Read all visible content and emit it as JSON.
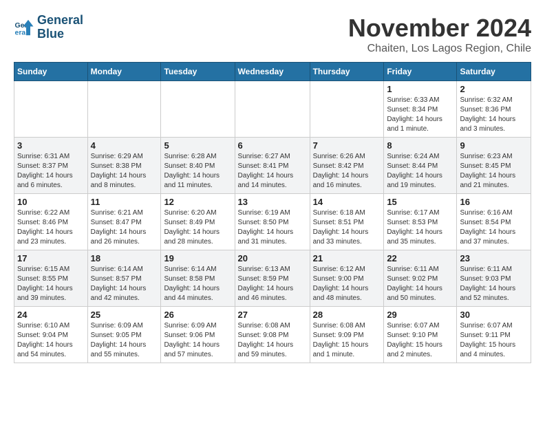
{
  "logo": {
    "line1": "General",
    "line2": "Blue"
  },
  "title": "November 2024",
  "subtitle": "Chaiten, Los Lagos Region, Chile",
  "days_of_week": [
    "Sunday",
    "Monday",
    "Tuesday",
    "Wednesday",
    "Thursday",
    "Friday",
    "Saturday"
  ],
  "weeks": [
    [
      {
        "day": "",
        "info": ""
      },
      {
        "day": "",
        "info": ""
      },
      {
        "day": "",
        "info": ""
      },
      {
        "day": "",
        "info": ""
      },
      {
        "day": "",
        "info": ""
      },
      {
        "day": "1",
        "info": "Sunrise: 6:33 AM\nSunset: 8:34 PM\nDaylight: 14 hours and 1 minute."
      },
      {
        "day": "2",
        "info": "Sunrise: 6:32 AM\nSunset: 8:36 PM\nDaylight: 14 hours and 3 minutes."
      }
    ],
    [
      {
        "day": "3",
        "info": "Sunrise: 6:31 AM\nSunset: 8:37 PM\nDaylight: 14 hours and 6 minutes."
      },
      {
        "day": "4",
        "info": "Sunrise: 6:29 AM\nSunset: 8:38 PM\nDaylight: 14 hours and 8 minutes."
      },
      {
        "day": "5",
        "info": "Sunrise: 6:28 AM\nSunset: 8:40 PM\nDaylight: 14 hours and 11 minutes."
      },
      {
        "day": "6",
        "info": "Sunrise: 6:27 AM\nSunset: 8:41 PM\nDaylight: 14 hours and 14 minutes."
      },
      {
        "day": "7",
        "info": "Sunrise: 6:26 AM\nSunset: 8:42 PM\nDaylight: 14 hours and 16 minutes."
      },
      {
        "day": "8",
        "info": "Sunrise: 6:24 AM\nSunset: 8:44 PM\nDaylight: 14 hours and 19 minutes."
      },
      {
        "day": "9",
        "info": "Sunrise: 6:23 AM\nSunset: 8:45 PM\nDaylight: 14 hours and 21 minutes."
      }
    ],
    [
      {
        "day": "10",
        "info": "Sunrise: 6:22 AM\nSunset: 8:46 PM\nDaylight: 14 hours and 23 minutes."
      },
      {
        "day": "11",
        "info": "Sunrise: 6:21 AM\nSunset: 8:47 PM\nDaylight: 14 hours and 26 minutes."
      },
      {
        "day": "12",
        "info": "Sunrise: 6:20 AM\nSunset: 8:49 PM\nDaylight: 14 hours and 28 minutes."
      },
      {
        "day": "13",
        "info": "Sunrise: 6:19 AM\nSunset: 8:50 PM\nDaylight: 14 hours and 31 minutes."
      },
      {
        "day": "14",
        "info": "Sunrise: 6:18 AM\nSunset: 8:51 PM\nDaylight: 14 hours and 33 minutes."
      },
      {
        "day": "15",
        "info": "Sunrise: 6:17 AM\nSunset: 8:53 PM\nDaylight: 14 hours and 35 minutes."
      },
      {
        "day": "16",
        "info": "Sunrise: 6:16 AM\nSunset: 8:54 PM\nDaylight: 14 hours and 37 minutes."
      }
    ],
    [
      {
        "day": "17",
        "info": "Sunrise: 6:15 AM\nSunset: 8:55 PM\nDaylight: 14 hours and 39 minutes."
      },
      {
        "day": "18",
        "info": "Sunrise: 6:14 AM\nSunset: 8:57 PM\nDaylight: 14 hours and 42 minutes."
      },
      {
        "day": "19",
        "info": "Sunrise: 6:14 AM\nSunset: 8:58 PM\nDaylight: 14 hours and 44 minutes."
      },
      {
        "day": "20",
        "info": "Sunrise: 6:13 AM\nSunset: 8:59 PM\nDaylight: 14 hours and 46 minutes."
      },
      {
        "day": "21",
        "info": "Sunrise: 6:12 AM\nSunset: 9:00 PM\nDaylight: 14 hours and 48 minutes."
      },
      {
        "day": "22",
        "info": "Sunrise: 6:11 AM\nSunset: 9:02 PM\nDaylight: 14 hours and 50 minutes."
      },
      {
        "day": "23",
        "info": "Sunrise: 6:11 AM\nSunset: 9:03 PM\nDaylight: 14 hours and 52 minutes."
      }
    ],
    [
      {
        "day": "24",
        "info": "Sunrise: 6:10 AM\nSunset: 9:04 PM\nDaylight: 14 hours and 54 minutes."
      },
      {
        "day": "25",
        "info": "Sunrise: 6:09 AM\nSunset: 9:05 PM\nDaylight: 14 hours and 55 minutes."
      },
      {
        "day": "26",
        "info": "Sunrise: 6:09 AM\nSunset: 9:06 PM\nDaylight: 14 hours and 57 minutes."
      },
      {
        "day": "27",
        "info": "Sunrise: 6:08 AM\nSunset: 9:08 PM\nDaylight: 14 hours and 59 minutes."
      },
      {
        "day": "28",
        "info": "Sunrise: 6:08 AM\nSunset: 9:09 PM\nDaylight: 15 hours and 1 minute."
      },
      {
        "day": "29",
        "info": "Sunrise: 6:07 AM\nSunset: 9:10 PM\nDaylight: 15 hours and 2 minutes."
      },
      {
        "day": "30",
        "info": "Sunrise: 6:07 AM\nSunset: 9:11 PM\nDaylight: 15 hours and 4 minutes."
      }
    ]
  ]
}
